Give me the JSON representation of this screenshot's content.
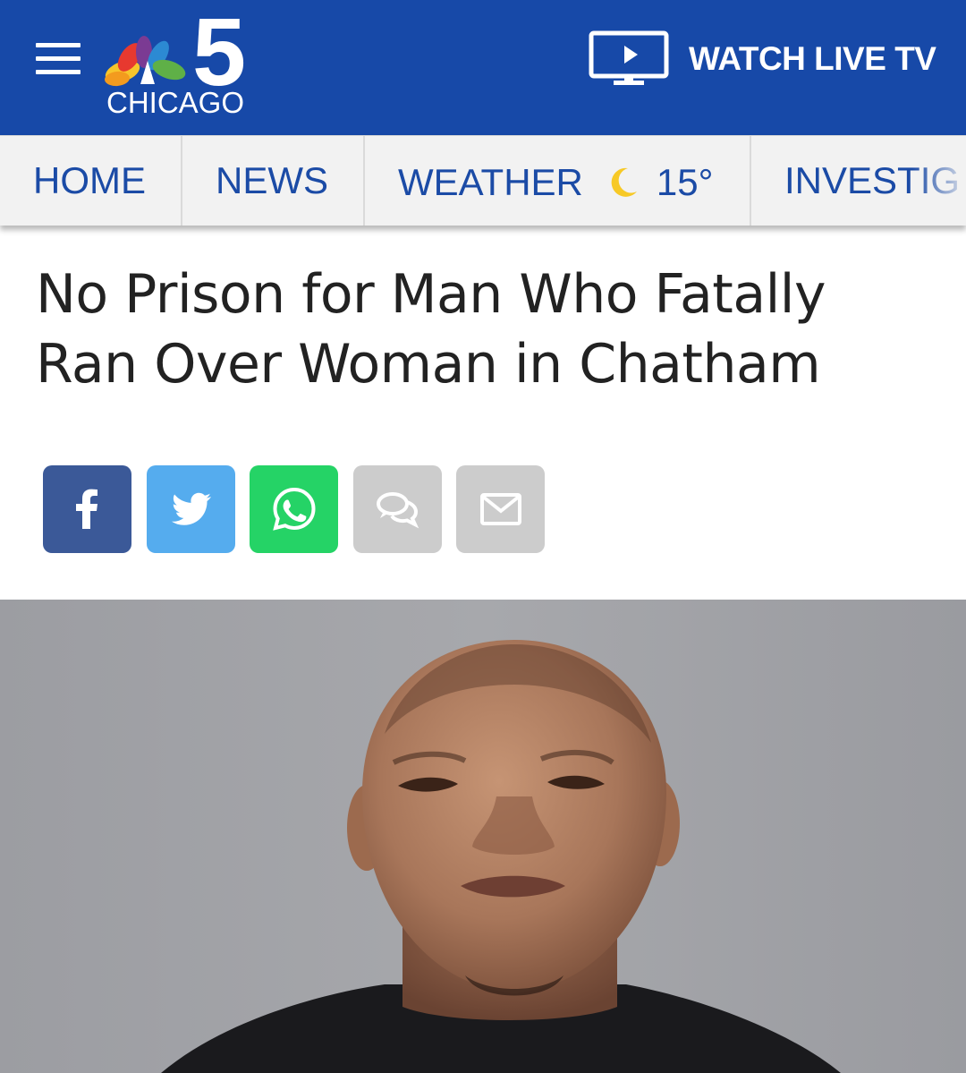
{
  "header": {
    "menu_icon": "hamburger-menu-icon",
    "logo": {
      "channel": "5",
      "city": "CHICAGO",
      "icon": "peacock-icon"
    },
    "watch_live": {
      "label": "WATCH LIVE TV",
      "icon": "tv-play-icon"
    },
    "background_color": "#1749a8"
  },
  "nav": {
    "items": [
      {
        "label": "HOME"
      },
      {
        "label": "NEWS"
      },
      {
        "label": "WEATHER",
        "temperature": "15°",
        "weather_icon": "moon-icon"
      },
      {
        "label": "INVESTIG"
      }
    ],
    "text_color": "#1b4ba6"
  },
  "article": {
    "headline_line1": "No Prison for Man Who Fatally",
    "headline_line2": "Ran Over Woman in Chatham"
  },
  "share": {
    "buttons": [
      {
        "name": "facebook",
        "icon": "facebook-icon",
        "color": "#3b5998"
      },
      {
        "name": "twitter",
        "icon": "twitter-icon",
        "color": "#55acee"
      },
      {
        "name": "whatsapp",
        "icon": "whatsapp-icon",
        "color": "#25d366"
      },
      {
        "name": "comments",
        "icon": "comments-icon",
        "color": "#cccccc"
      },
      {
        "name": "email",
        "icon": "email-icon",
        "color": "#cccccc"
      }
    ]
  },
  "photo": {
    "subject": "booking-photo"
  }
}
